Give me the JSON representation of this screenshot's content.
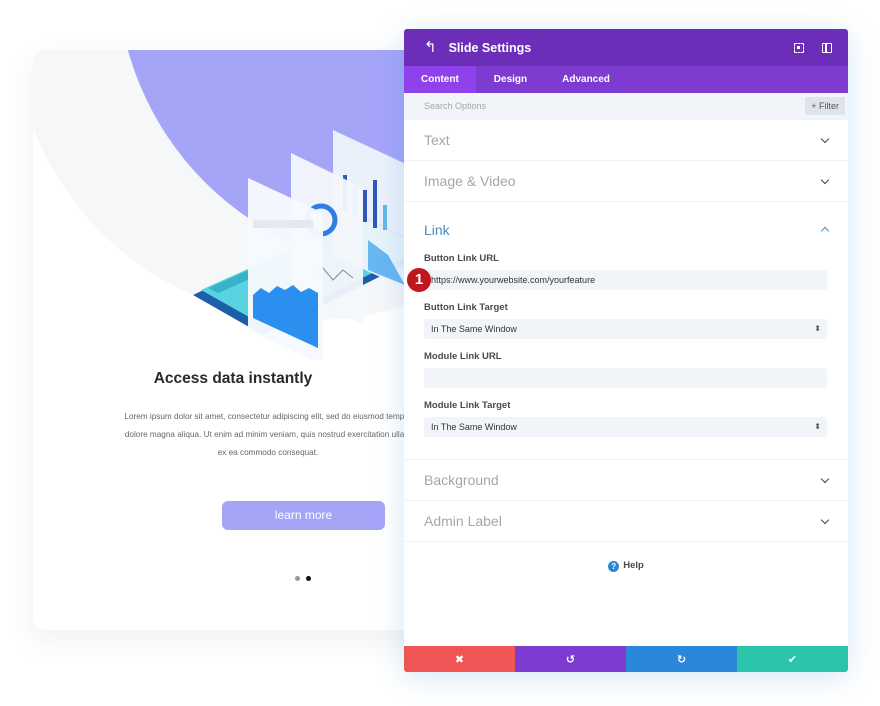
{
  "preview": {
    "title": "Access data instantly",
    "body_lines": [
      "Lorem ipsum dolor sit amet, consectetur adipiscing elit, sed do eiusmod tempor",
      "dolore magna aliqua. Ut enim ad minim veniam, quis nostrud exercitation ullam",
      "ex ea commodo consequat."
    ],
    "button_label": "learn more",
    "slides": {
      "count": 2,
      "active_index": 1
    },
    "colors": {
      "accent": "#a5a5f8"
    }
  },
  "panel": {
    "title": "Slide Settings",
    "back_icon": "undo-arrow-icon",
    "header_icons": [
      "expand-icon",
      "split-view-icon"
    ],
    "tabs": [
      {
        "label": "Content",
        "active": true
      },
      {
        "label": "Design",
        "active": false
      },
      {
        "label": "Advanced",
        "active": false
      }
    ],
    "search": {
      "placeholder": "Search Options",
      "filter_label": "+ Filter"
    },
    "sections": {
      "text": "Text",
      "image_video": "Image & Video",
      "link": "Link",
      "background": "Background",
      "admin_label": "Admin Label"
    },
    "link_fields": {
      "button_link_url": {
        "label": "Button Link URL",
        "value": "https://www.yourwebsite.com/yourfeature",
        "badge": "1"
      },
      "button_link_target": {
        "label": "Button Link Target",
        "value": "In The Same Window"
      },
      "module_link_url": {
        "label": "Module Link URL",
        "value": ""
      },
      "module_link_target": {
        "label": "Module Link Target",
        "value": "In The Same Window"
      }
    },
    "help_label": "Help",
    "footer": {
      "cancel": "✖",
      "undo": "↺",
      "redo": "↻",
      "save": "✔"
    },
    "colors": {
      "header": "#6c2eb9",
      "tabs": "#7d3bcf",
      "cancel": "#ef5555",
      "undo": "#7e3bd0",
      "redo": "#2b87da",
      "save": "#29c4a9"
    }
  }
}
